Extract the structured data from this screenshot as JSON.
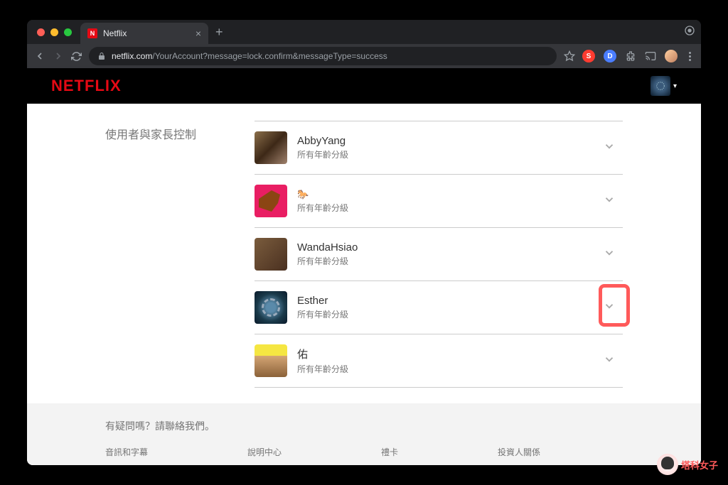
{
  "browser": {
    "tab_title": "Netflix",
    "url_domain": "netflix.com",
    "url_path": "/YourAccount?message=lock.confirm&messageType=success"
  },
  "header": {
    "logo": "NETFLIX"
  },
  "section": {
    "label": "使用者與家長控制"
  },
  "profiles": [
    {
      "name": "AbbyYang",
      "sub": "所有年齡分級",
      "avatar": "av1"
    },
    {
      "name": "🐎",
      "sub": "所有年齡分級",
      "avatar": "av2"
    },
    {
      "name": "WandaHsiao",
      "sub": "所有年齡分級",
      "avatar": "av3"
    },
    {
      "name": "Esther",
      "sub": "所有年齡分級",
      "avatar": "av4",
      "highlighted": true
    },
    {
      "name": "佑",
      "sub": "所有年齡分級",
      "avatar": "av5"
    }
  ],
  "footer": {
    "question": "有疑問嗎？請聯絡我們。",
    "links": [
      "音訊和字幕",
      "說明中心",
      "禮卡",
      "投資人關係"
    ]
  },
  "watermark": "塔科女子"
}
